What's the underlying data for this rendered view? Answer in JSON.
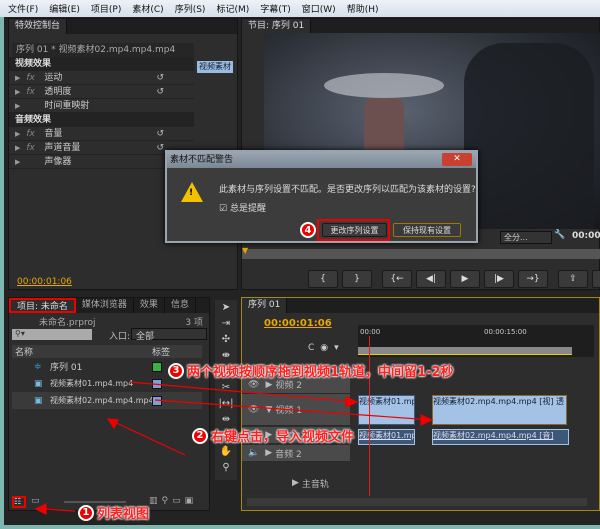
{
  "menu": [
    "文件(F)",
    "编辑(E)",
    "项目(P)",
    "素材(C)",
    "序列(S)",
    "标记(M)",
    "字幕(T)",
    "窗口(W)",
    "帮助(H)"
  ],
  "effects": {
    "tab": "特效控制台",
    "clip": "序列 01 * 视频素材02.mp4.mp4.mp4",
    "timeline_clip": "视频素材",
    "video_section": "视频效果",
    "video_items": [
      "运动",
      "透明度",
      "时间重映射"
    ],
    "audio_section": "音频效果",
    "audio_items": [
      "音量",
      "声道音量",
      "声像器"
    ],
    "timecode": "00:00:01:06"
  },
  "program": {
    "tab": "节目: 序列 01",
    "fit": "全分...",
    "timecode": "00:00:",
    "transport": [
      "{",
      "}",
      "{←",
      "◀|",
      "▶",
      "|▶",
      "→}",
      "⇪",
      "⇩"
    ]
  },
  "dialog": {
    "title": "素材不匹配警告",
    "message": "此素材与序列设置不匹配。是否更改序列以匹配为该素材的设置?",
    "checkbox": "总是提醒",
    "btn_change": "更改序列设置",
    "btn_keep": "保持现有设置",
    "close": "✕"
  },
  "project": {
    "tabs": [
      "项目: 未命名",
      "媒体浏览器",
      "效果",
      "信息"
    ],
    "file": "未命名.prproj",
    "count": "3 项",
    "entry_label": "入口:",
    "entry_value": "全部",
    "col_name": "名称",
    "col_label": "标签",
    "items": [
      {
        "name": "序列 01",
        "color": "#3cb043"
      },
      {
        "name": "视频素材01.mp4.mp4",
        "color": "#7b9fd6"
      },
      {
        "name": "视频素材02.mp4.mp4.mp4",
        "color": "#7b9fd6"
      }
    ]
  },
  "timeline": {
    "tab": "序列 01",
    "timecode": "00:00:01:06",
    "ruler": [
      "00:00",
      "00:00:15:00"
    ],
    "tracks": [
      "视频 2",
      "视频 1",
      "音频 1",
      "音频 2",
      "主音轨"
    ],
    "clips": {
      "v1a": "视频素材01.mp",
      "v1b": "视频素材02.mp4.mp4.mp4 [视] 透",
      "a1a": "视频素材01.mp",
      "a1b": "视频素材02.mp4.mp4.mp4 [音]"
    }
  },
  "annotations": {
    "a1": {
      "num": "1",
      "text": "列表视图"
    },
    "a2": {
      "num": "2",
      "text": "右键点击，导入视频文件"
    },
    "a3": {
      "num": "3",
      "text": "两个视频按顺序拖到视频1轨道，中间留1-2秒"
    },
    "a4": {
      "num": "4"
    }
  },
  "colors": {
    "accent": "#e8a800",
    "annotation": "#ff0000"
  }
}
